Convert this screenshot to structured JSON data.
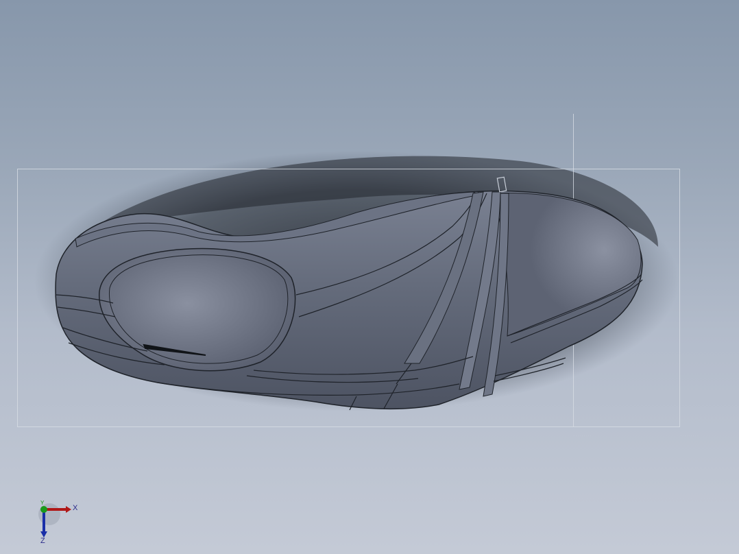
{
  "viewport": {
    "background_top": "#8797ab",
    "background_bottom": "#c4cad6"
  },
  "model": {
    "part": "shoe-sole",
    "body_color": "#5e6575",
    "edge_color": "#1e2229"
  },
  "triad": {
    "x_label": "X",
    "y_label": "Y",
    "z_label": "Z",
    "x_color": "#b01818",
    "y_color": "#1a9a1a",
    "z_color": "#1a2fa8"
  }
}
